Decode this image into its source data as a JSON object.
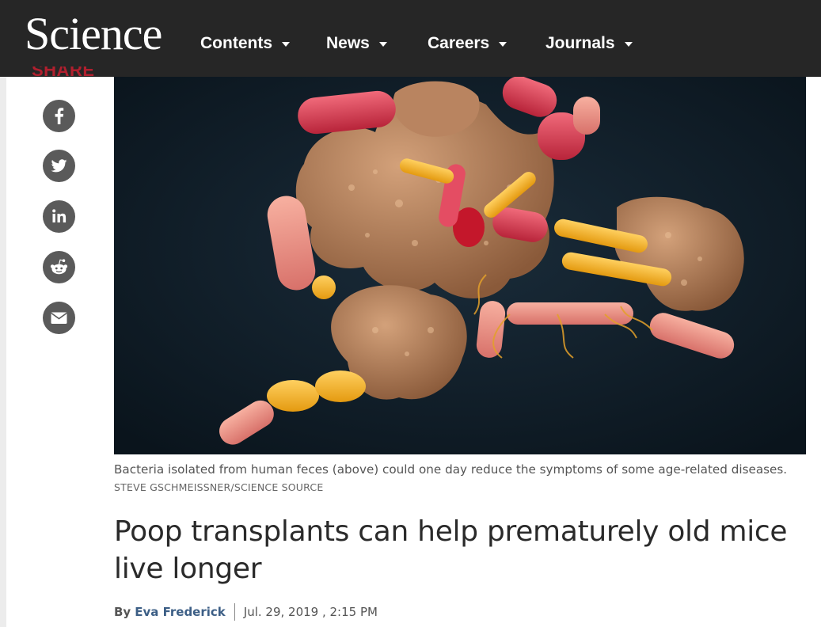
{
  "header": {
    "logo": "Science",
    "nav": [
      {
        "label": "Contents"
      },
      {
        "label": "News"
      },
      {
        "label": "Careers"
      },
      {
        "label": "Journals"
      }
    ]
  },
  "share": {
    "label": "SHARE",
    "buttons": [
      {
        "icon": "facebook-icon"
      },
      {
        "icon": "twitter-icon"
      },
      {
        "icon": "linkedin-icon"
      },
      {
        "icon": "reddit-icon"
      },
      {
        "icon": "email-icon"
      }
    ]
  },
  "article": {
    "caption": "Bacteria isolated from human feces (above) could one day reduce the symptoms of some age-related diseases.",
    "credit": "STEVE GSCHMEISSNER/SCIENCE SOURCE",
    "headline": "Poop transplants can help prematurely old mice live longer",
    "byline_prefix": "By",
    "author": "Eva Frederick",
    "date": "Jul. 29, 2019 , 2:15 PM"
  },
  "colors": {
    "header_bg": "#262626",
    "share_label": "#b01f2e",
    "author_link": "#3d5f86"
  }
}
